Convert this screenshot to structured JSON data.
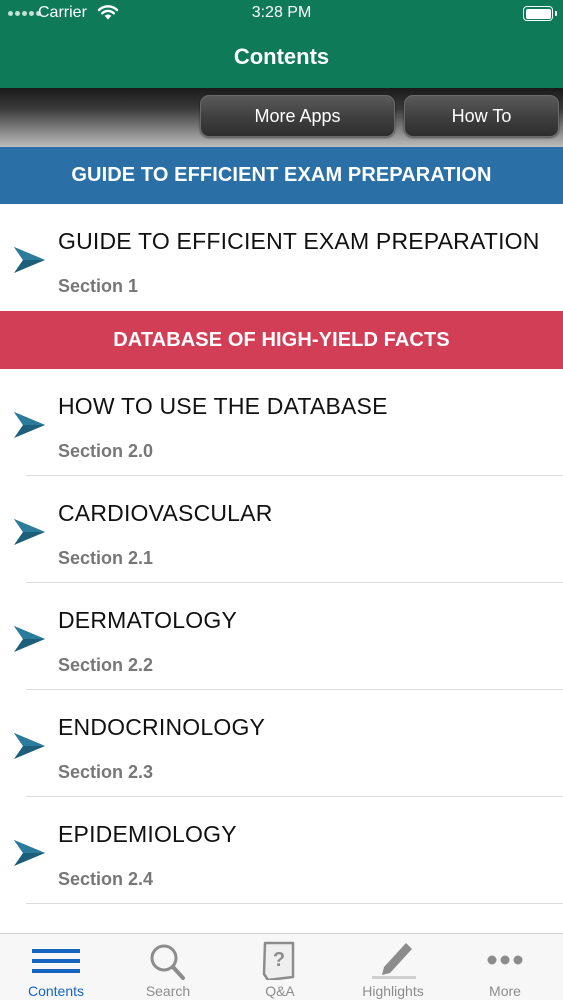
{
  "status_bar": {
    "carrier": "Carrier",
    "time": "3:28 PM"
  },
  "nav": {
    "title": "Contents"
  },
  "toolbar": {
    "more_apps_label": "More Apps",
    "how_to_label": "How To"
  },
  "sections": [
    {
      "header": "GUIDE TO EFFICIENT EXAM PREPARATION",
      "color": "#2a6fa6",
      "items": [
        {
          "title": "GUIDE TO EFFICIENT EXAM PREPARATION",
          "subtitle": "Section 1"
        }
      ]
    },
    {
      "header": "DATABASE OF HIGH-YIELD FACTS",
      "color": "#d33e57",
      "items": [
        {
          "title": "HOW TO USE THE DATABASE",
          "subtitle": "Section 2.0"
        },
        {
          "title": "CARDIOVASCULAR",
          "subtitle": "Section 2.1"
        },
        {
          "title": "DERMATOLOGY",
          "subtitle": "Section 2.2"
        },
        {
          "title": "ENDOCRINOLOGY",
          "subtitle": "Section 2.3"
        },
        {
          "title": "EPIDEMIOLOGY",
          "subtitle": "Section 2.4"
        }
      ]
    }
  ],
  "tab_bar": {
    "active": "Contents",
    "tabs": [
      {
        "label": "Contents",
        "icon": "list-icon"
      },
      {
        "label": "Search",
        "icon": "magnifier-icon"
      },
      {
        "label": "Q&A",
        "icon": "question-card-icon"
      },
      {
        "label": "Highlights",
        "icon": "highlighter-icon"
      },
      {
        "label": "More",
        "icon": "ellipsis-icon"
      }
    ]
  },
  "colors": {
    "nav_green": "#0e7a58",
    "tab_active": "#1565c0",
    "tab_inactive": "#8c8c8c",
    "chevron": "#1d5f7a"
  }
}
